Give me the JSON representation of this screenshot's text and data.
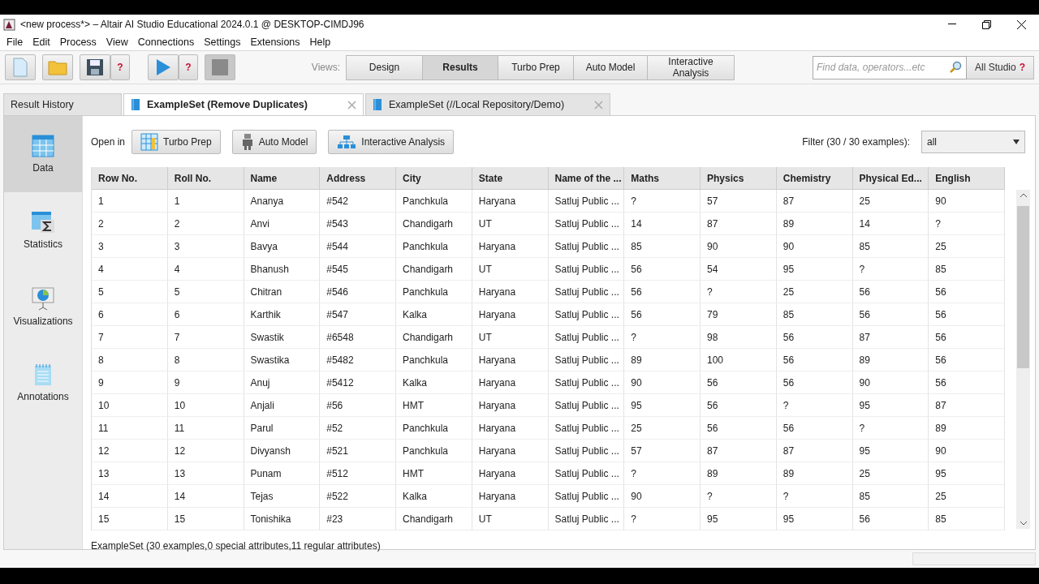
{
  "window": {
    "title": "<new process*> – Altair AI Studio Educational 2024.0.1 @ DESKTOP-CIMDJ96"
  },
  "menu": [
    "File",
    "Edit",
    "Process",
    "View",
    "Connections",
    "Settings",
    "Extensions",
    "Help"
  ],
  "toolbar": {
    "groups": [
      {
        "kind": "new"
      },
      {
        "kind": "open"
      },
      {
        "kind": "save",
        "help": "?"
      },
      {
        "kind": "run",
        "help": "?"
      },
      {
        "kind": "stop"
      }
    ],
    "views_label": "Views:",
    "views": [
      {
        "label": "Design",
        "selected": false
      },
      {
        "label": "Results",
        "selected": true
      },
      {
        "label": "Turbo Prep",
        "selected": false
      },
      {
        "label": "Auto Model",
        "selected": false
      },
      {
        "label": "Interactive Analysis",
        "selected": false
      }
    ],
    "search": {
      "placeholder": "Find data, operators...etc"
    },
    "studio_button": {
      "label": "All Studio",
      "help": "?"
    }
  },
  "result_tabs": [
    {
      "label": "Result History",
      "kind": "history",
      "selected": false
    },
    {
      "label": "ExampleSet (Remove Duplicates)",
      "kind": "example",
      "selected": true
    },
    {
      "label": "ExampleSet (//Local Repository/Demo)",
      "kind": "example",
      "selected": false
    }
  ],
  "sidebar": {
    "items": [
      {
        "label": "Data",
        "kind": "data",
        "selected": true
      },
      {
        "label": "Statistics",
        "kind": "statistics",
        "selected": false
      },
      {
        "label": "Visualizations",
        "kind": "visualizations",
        "selected": false
      },
      {
        "label": "Annotations",
        "kind": "annotations",
        "selected": false
      }
    ]
  },
  "open_in": {
    "label": "Open in",
    "buttons": [
      {
        "label": "Turbo Prep",
        "kind": "turbo"
      },
      {
        "label": "Auto Model",
        "kind": "robot"
      },
      {
        "label": "Interactive Analysis",
        "kind": "hierarchy"
      }
    ]
  },
  "filter": {
    "label": "Filter (30 / 30 examples):",
    "value": "all"
  },
  "table": {
    "columns": [
      "Row No.",
      "Roll No.",
      "Name",
      "Address",
      "City",
      "State",
      "Name of the ...",
      "Maths",
      "Physics",
      "Chemistry",
      "Physical Ed...",
      "English"
    ],
    "rows": [
      [
        "1",
        "1",
        "Ananya",
        "#542",
        "Panchkula",
        "Haryana",
        "Satluj Public ...",
        "?",
        "57",
        "87",
        "25",
        "90"
      ],
      [
        "2",
        "2",
        "Anvi",
        "#543",
        "Chandigarh",
        "UT",
        "Satluj Public ...",
        "14",
        "87",
        "89",
        "14",
        "?"
      ],
      [
        "3",
        "3",
        "Bavya",
        "#544",
        "Panchkula",
        "Haryana",
        "Satluj Public ...",
        "85",
        "90",
        "90",
        "85",
        "25"
      ],
      [
        "4",
        "4",
        "Bhanush",
        "#545",
        "Chandigarh",
        "UT",
        "Satluj Public ...",
        "56",
        "54",
        "95",
        "?",
        "85"
      ],
      [
        "5",
        "5",
        "Chitran",
        "#546",
        "Panchkula",
        "Haryana",
        "Satluj Public ...",
        "56",
        "?",
        "25",
        "56",
        "56"
      ],
      [
        "6",
        "6",
        "Karthik",
        "#547",
        "Kalka",
        "Haryana",
        "Satluj Public ...",
        "56",
        "79",
        "85",
        "56",
        "56"
      ],
      [
        "7",
        "7",
        "Swastik",
        "#6548",
        "Chandigarh",
        "UT",
        "Satluj Public ...",
        "?",
        "98",
        "56",
        "87",
        "56"
      ],
      [
        "8",
        "8",
        "Swastika",
        "#5482",
        "Panchkula",
        "Haryana",
        "Satluj Public ...",
        "89",
        "100",
        "56",
        "89",
        "56"
      ],
      [
        "9",
        "9",
        "Anuj",
        "#5412",
        "Kalka",
        "Haryana",
        "Satluj Public ...",
        "90",
        "56",
        "56",
        "90",
        "56"
      ],
      [
        "10",
        "10",
        "Anjali",
        "#56",
        "HMT",
        "Haryana",
        "Satluj Public ...",
        "95",
        "56",
        "?",
        "95",
        "87"
      ],
      [
        "11",
        "11",
        "Parul",
        "#52",
        "Panchkula",
        "Haryana",
        "Satluj Public ...",
        "25",
        "56",
        "56",
        "?",
        "89"
      ],
      [
        "12",
        "12",
        "Divyansh",
        "#521",
        "Panchkula",
        "Haryana",
        "Satluj Public ...",
        "57",
        "87",
        "87",
        "95",
        "90"
      ],
      [
        "13",
        "13",
        "Punam",
        "#512",
        "HMT",
        "Haryana",
        "Satluj Public ...",
        "?",
        "89",
        "89",
        "25",
        "95"
      ],
      [
        "14",
        "14",
        "Tejas",
        "#522",
        "Kalka",
        "Haryana",
        "Satluj Public ...",
        "90",
        "?",
        "?",
        "85",
        "25"
      ],
      [
        "15",
        "15",
        "Tonishika",
        "#23",
        "Chandigarh",
        "UT",
        "Satluj Public ...",
        "?",
        "95",
        "95",
        "56",
        "85"
      ]
    ]
  },
  "status": "ExampleSet (30 examples,0 special attributes,11 regular attributes)"
}
